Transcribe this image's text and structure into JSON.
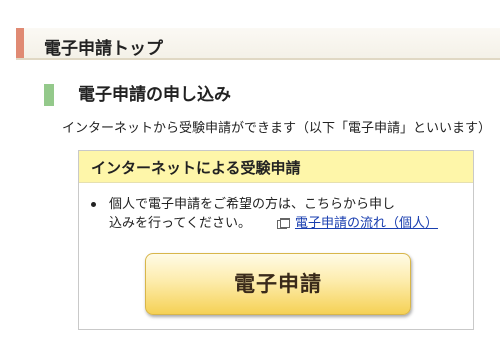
{
  "breadcrumb": {
    "text": ""
  },
  "page": {
    "title": "電子申請トップ"
  },
  "section": {
    "heading": "電子申請の申し込み",
    "intro": "インターネットから受験申請ができます（以下「電子申請」といいます）"
  },
  "box": {
    "header": "インターネットによる受験申請",
    "bullet_line1": "個人で電子申請をご希望の方は、こちらから申し",
    "bullet_line2": "込みを行ってください。",
    "link_label": "電子申請の流れ（個人）",
    "link_icon": "new-window-icon",
    "button_label": "電子申請"
  },
  "colors": {
    "title_accent": "#e08a73",
    "section_accent": "#94c98b",
    "box_header_bg": "#fef6a9",
    "link": "#1a3fb0",
    "button_gold": "#f5d155"
  }
}
